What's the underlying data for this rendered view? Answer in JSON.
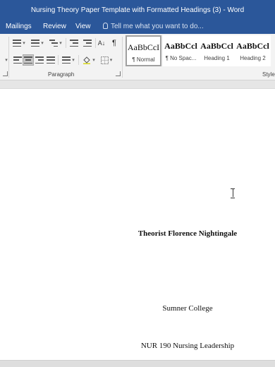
{
  "window": {
    "title": "Nursing Theory Paper Template with Formatted Headings (3) - Word"
  },
  "tabs": [
    {
      "label": "Mailings"
    },
    {
      "label": "Review"
    },
    {
      "label": "View"
    }
  ],
  "tell_me": {
    "placeholder": "Tell me what you want to do..."
  },
  "ribbon": {
    "paragraph_group_label": "Paragraph",
    "styles_group_label": "Styles",
    "pilcrow": "¶",
    "sort": "A↓",
    "styles": [
      {
        "preview": "AaBbCcI",
        "name": "¶ Normal",
        "active": true
      },
      {
        "preview": "AaBbCcl",
        "name": "¶ No Spac...",
        "active": false
      },
      {
        "preview": "AaBbCcl",
        "name": "Heading 1",
        "active": false
      },
      {
        "preview": "AaBbCcl",
        "name": "Heading 2",
        "active": false
      }
    ]
  },
  "document": {
    "title": "Theorist Florence Nightingale",
    "college": "Sumner College",
    "course": "NUR 190 Nursing Leadership"
  }
}
